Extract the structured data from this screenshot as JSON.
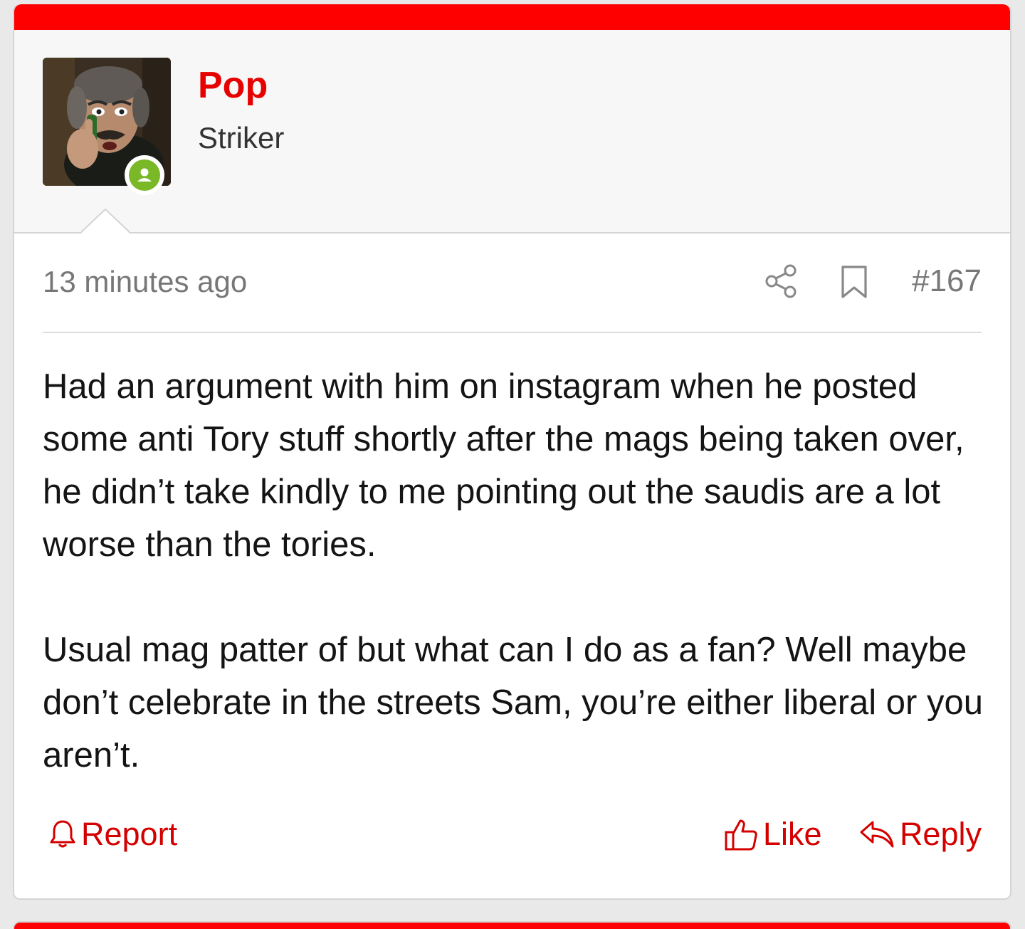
{
  "colors": {
    "accent": "#ff0000",
    "link": "#d40000",
    "online": "#7ab828"
  },
  "user": {
    "name": "Pop",
    "title": "Striker",
    "status_icon": "online-user-icon"
  },
  "meta": {
    "timestamp": "13 minutes ago",
    "post_number": "#167",
    "share_icon": "share-icon",
    "bookmark_icon": "bookmark-icon"
  },
  "body": {
    "paragraphs": [
      "Had an argument with him on instagram when he posted some anti Tory stuff shortly after the mags being taken over, he didn’t take kindly to me pointing out the saudis are a lot worse than the tories.",
      "Usual mag patter of but what can I do as a fan? Well maybe don’t celebrate in the streets Sam, you’re either liberal or you aren’t."
    ]
  },
  "actions": {
    "report": "Report",
    "like": "Like",
    "reply": "Reply"
  }
}
